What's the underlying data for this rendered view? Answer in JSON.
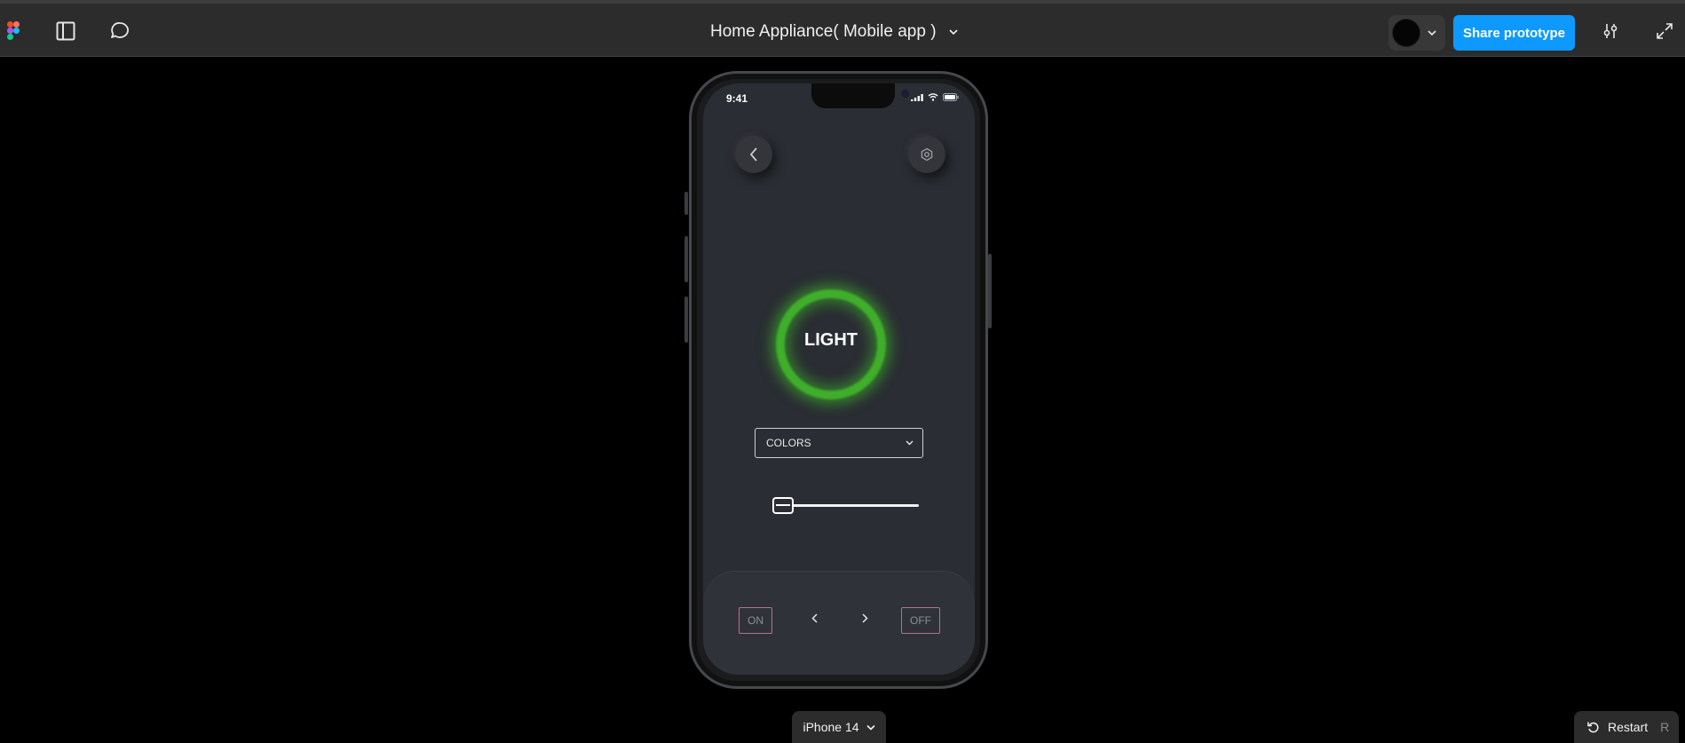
{
  "toolbar": {
    "title": "Home Appliance( Mobile app )",
    "share_label": "Share prototype",
    "icons": [
      "figma-logo",
      "sidebar-icon",
      "comment-icon",
      "chevron-down-icon",
      "settings-sliders-icon",
      "expand-icon"
    ]
  },
  "phone": {
    "status_time": "9:41",
    "center_label": "LIGHT",
    "dropdown": {
      "selected": "COLORS"
    },
    "slider": {
      "value_fraction": 0.03
    },
    "controls": {
      "on_label": "ON",
      "off_label": "OFF"
    },
    "ring_color": "#3fae2a"
  },
  "footer": {
    "device_label": "iPhone 14",
    "restart_label": "Restart",
    "restart_shortcut": "R"
  },
  "colors": {
    "accent": "#0d99ff",
    "toolbar_bg": "#2c2c2c",
    "screen_bg": "#2a2d33"
  }
}
